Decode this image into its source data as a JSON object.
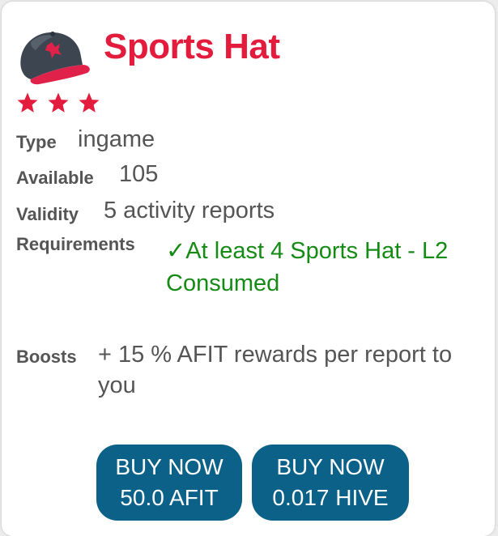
{
  "item": {
    "icon": "sports-hat-icon",
    "title": "Sports Hat",
    "stars": 3,
    "type_label": "Type",
    "type_value": "ingame",
    "available_label": "Available",
    "available_value": "105",
    "validity_label": "Validity",
    "validity_value": "5 activity reports",
    "requirements_label": "Requirements",
    "requirements_value": "✓At least 4 Sports Hat - L2 Consumed",
    "boosts_label": "Boosts",
    "boosts_value": "+ 15 % AFIT rewards per report to you"
  },
  "buttons": {
    "afit_line1": "BUY NOW",
    "afit_line2": "50.0 AFIT",
    "hive_line1": "BUY NOW",
    "hive_line2": "0.017 HIVE"
  },
  "colors": {
    "title": "#e31c3d",
    "star": "#e31c3d",
    "requirement": "#158a15",
    "button": "#0b6188",
    "text": "#555555"
  }
}
